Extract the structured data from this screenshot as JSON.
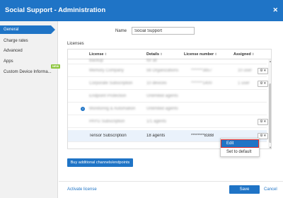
{
  "titlebar": {
    "title": "Social Support - Administration",
    "close_icon": "close-icon"
  },
  "sidebar": {
    "items": [
      {
        "label": "General",
        "active": true
      },
      {
        "label": "Charge rates"
      },
      {
        "label": "Advanced"
      },
      {
        "label": "Apps"
      },
      {
        "label": "Custom Device Informa...",
        "badge": "NEW"
      }
    ]
  },
  "form": {
    "name_label": "Name",
    "name_value": "Social Support"
  },
  "licenses": {
    "section_label": "Licenses",
    "columns": [
      "License",
      "Details",
      "License number",
      "Assigned"
    ],
    "rows": [
      {
        "license": "Backup",
        "details": "for all",
        "number": "",
        "assigned": ""
      },
      {
        "license": "Memory Company",
        "details": "56 Organizations",
        "number": "*******3857",
        "assigned": "10 user"
      },
      {
        "license": "Corporate Subscription",
        "details": "10 devices",
        "number": "*******1400",
        "assigned": "1 user"
      },
      {
        "license": "Endpoint Protection",
        "details": "Unlimited agents",
        "number": "",
        "assigned": ""
      },
      {
        "license": "Monitoring & Automation",
        "details": "Unlimited agents",
        "number": "",
        "assigned": ""
      },
      {
        "license": "PAYG Subscription",
        "details": "1/1 agents",
        "number": "",
        "assigned": ""
      },
      {
        "license": "Tensor Subscription",
        "details": "18 agents",
        "number": "********8388",
        "assigned": ""
      }
    ],
    "context_menu": {
      "edit": "Edit",
      "set_default": "Set to default"
    }
  },
  "buttons": {
    "additional": "Buy additional channels/endpoints",
    "activate": "Activate license",
    "save": "Save",
    "cancel": "Cancel"
  },
  "colors": {
    "accent": "#1f74c6",
    "badge": "#8dc63f",
    "highlight_border": "#e02b2b"
  }
}
